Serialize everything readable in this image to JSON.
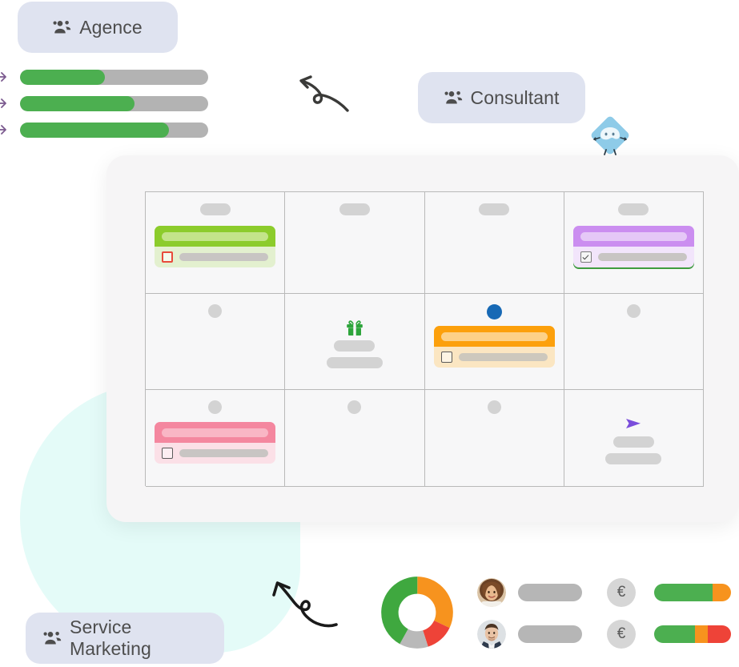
{
  "pills": [
    {
      "id": "agence",
      "label": "Agence",
      "icon": "group-icon",
      "bg": "#dfe3f0",
      "text": "#4d4d4d"
    },
    {
      "id": "consultant",
      "label": "Consultant",
      "icon": "group-icon",
      "bg": "#dfe3f0",
      "text": "#4d4d4d"
    },
    {
      "id": "service",
      "label": "Service Marketing",
      "icon": "group-icon",
      "bg": "#dfe3f0",
      "text": "#4d4d4d"
    }
  ],
  "left_progress": {
    "arrow_icon": "arrow-right-icon",
    "track_color": "#b3b3b3",
    "fill_color": "#4caf50",
    "bars": [
      {
        "percent": 45
      },
      {
        "percent": 61
      },
      {
        "percent": 79
      }
    ]
  },
  "mascot": {
    "icon": "diamond-mascot-icon",
    "body_color": "#8ecbe8",
    "face_color": "#eef7fb"
  },
  "squiggles": [
    {
      "id": "top",
      "icon": "curly-arrow-left-icon",
      "color": "#3a3a38"
    },
    {
      "id": "bottom",
      "icon": "curly-arrow-upleft-icon",
      "color": "#1a1a1a"
    }
  ],
  "blob": {
    "color": "#e4fbf8"
  },
  "board": {
    "background": "#f6f5f6",
    "grid": {
      "columns": 4,
      "rows": 3,
      "border_color": "#b9b9b9",
      "cell_background": "#f7f7f8",
      "cells": [
        {
          "row": 1,
          "col": 1,
          "marker": {
            "type": "pill",
            "color": "#d3d3d3"
          },
          "event": {
            "head_color": "#8ccc2c",
            "head_bar_color": "#c3e48a",
            "body_color": "#e3f0cf",
            "checkbox": {
              "state": "unchecked",
              "border": "#e8493a",
              "fill": "#f4f9ec"
            },
            "body_bar_color": "#c8c5c3"
          }
        },
        {
          "row": 1,
          "col": 2,
          "marker": {
            "type": "pill",
            "color": "#d3d3d3"
          }
        },
        {
          "row": 1,
          "col": 3,
          "marker": {
            "type": "pill",
            "color": "#d3d3d3"
          }
        },
        {
          "row": 1,
          "col": 4,
          "marker": {
            "type": "pill",
            "color": "#d3d3d3"
          },
          "event": {
            "head_color": "#cb8ef0",
            "head_bar_color": "#e5c8f7",
            "body_color": "#f2e5fb",
            "checkbox": {
              "state": "checked",
              "border": "#7a7a7a",
              "fill": "#f5f5f5"
            },
            "body_bar_color": "#c8c5c3",
            "under_bar_color": "#3f9c40"
          }
        },
        {
          "row": 2,
          "col": 1,
          "marker": {
            "type": "dot",
            "color": "#d3d3d3"
          }
        },
        {
          "row": 2,
          "col": 2,
          "marker": {
            "type": "dot",
            "color": "#d3d3d3"
          },
          "icon": {
            "name": "gift-icon",
            "color": "#2ea53c"
          },
          "placeholders": 2
        },
        {
          "row": 2,
          "col": 3,
          "marker": {
            "type": "dot",
            "color": "#1769b5",
            "variant": "blue"
          },
          "event": {
            "head_color": "#fca00c",
            "head_bar_color": "#fdd188",
            "body_color": "#fbe6c2",
            "checkbox": {
              "state": "unchecked",
              "border": "#5a5a5a",
              "fill": "#fdf4e4"
            },
            "body_bar_color": "#cdc8bd"
          }
        },
        {
          "row": 2,
          "col": 4,
          "marker": {
            "type": "dot",
            "color": "#d3d3d3"
          }
        },
        {
          "row": 3,
          "col": 1,
          "marker": {
            "type": "dot",
            "color": "#d3d3d3"
          },
          "event": {
            "head_color": "#f4879f",
            "head_bar_color": "#f9b6c5",
            "body_color": "#fbe0e7",
            "checkbox": {
              "state": "unchecked",
              "border": "#5a5a5a",
              "fill": "#fdeef2"
            },
            "body_bar_color": "#c8c5c3"
          }
        },
        {
          "row": 3,
          "col": 2,
          "marker": {
            "type": "dot",
            "color": "#d3d3d3"
          }
        },
        {
          "row": 3,
          "col": 3,
          "marker": {
            "type": "dot",
            "color": "#d3d3d3"
          }
        },
        {
          "row": 3,
          "col": 4,
          "icon": {
            "name": "send-icon",
            "color": "#7a4ddb"
          },
          "placeholders": 2
        }
      ]
    }
  },
  "chart_data": {
    "type": "pie",
    "title": "",
    "variant": "donut",
    "categories": [
      "Green",
      "Orange",
      "Red",
      "Gray"
    ],
    "values": [
      42,
      32,
      13,
      13
    ],
    "colors": [
      "#3fa83f",
      "#f7931e",
      "#ee4338",
      "#b9b9b9"
    ],
    "legend": "none"
  },
  "people": [
    {
      "avatar": "avatar-woman",
      "bar_color": "#b6b6b6"
    },
    {
      "avatar": "avatar-man",
      "bar_color": "#b6b6b6"
    }
  ],
  "euro_rows": [
    {
      "badge": {
        "icon": "euro-icon",
        "symbol": "€",
        "bg": "#d6d6d6",
        "color": "#5a5a5a"
      },
      "segments": [
        {
          "color": "#4caf50",
          "percent": 76
        },
        {
          "color": "#f7931e",
          "percent": 24
        }
      ]
    },
    {
      "badge": {
        "icon": "euro-icon",
        "symbol": "€",
        "bg": "#d6d6d6",
        "color": "#5a5a5a"
      },
      "segments": [
        {
          "color": "#4caf50",
          "percent": 53
        },
        {
          "color": "#f7931e",
          "percent": 17
        },
        {
          "color": "#ee4338",
          "percent": 30
        }
      ]
    }
  ]
}
